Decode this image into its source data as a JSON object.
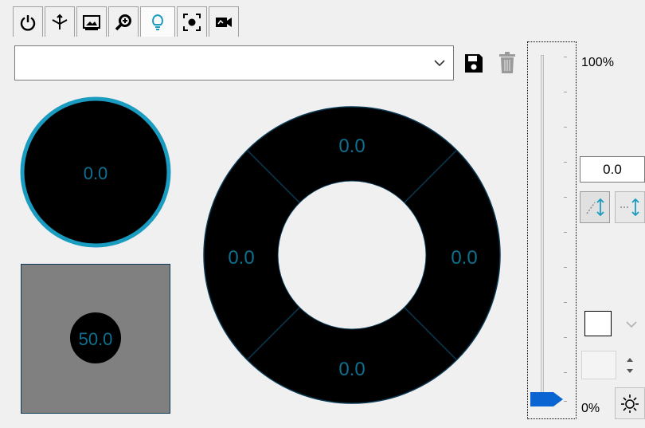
{
  "tabs": [
    {
      "id": "power",
      "icon": "power-icon"
    },
    {
      "id": "joystick",
      "icon": "joystick-icon"
    },
    {
      "id": "image",
      "icon": "image-icon"
    },
    {
      "id": "zoom",
      "icon": "zoom-icon"
    },
    {
      "id": "light",
      "icon": "lightbulb-icon",
      "active": true
    },
    {
      "id": "focus",
      "icon": "focus-icon"
    },
    {
      "id": "camera",
      "icon": "camera-icon"
    }
  ],
  "preset": {
    "selected": ""
  },
  "indicators": {
    "circle_value": "0.0",
    "box_value": "50.0",
    "ring_top": "0.0",
    "ring_left": "0.0",
    "ring_right": "0.0",
    "ring_bottom": "0.0"
  },
  "slider": {
    "max_label": "100%",
    "min_label": "0%",
    "value_percent": 0
  },
  "value_field": "0.0",
  "colors": {
    "accent": "#1a9bc0",
    "indicator_text": "#0e6f8e",
    "thumb": "#0a64d2",
    "panel": "#f0f0f0"
  }
}
